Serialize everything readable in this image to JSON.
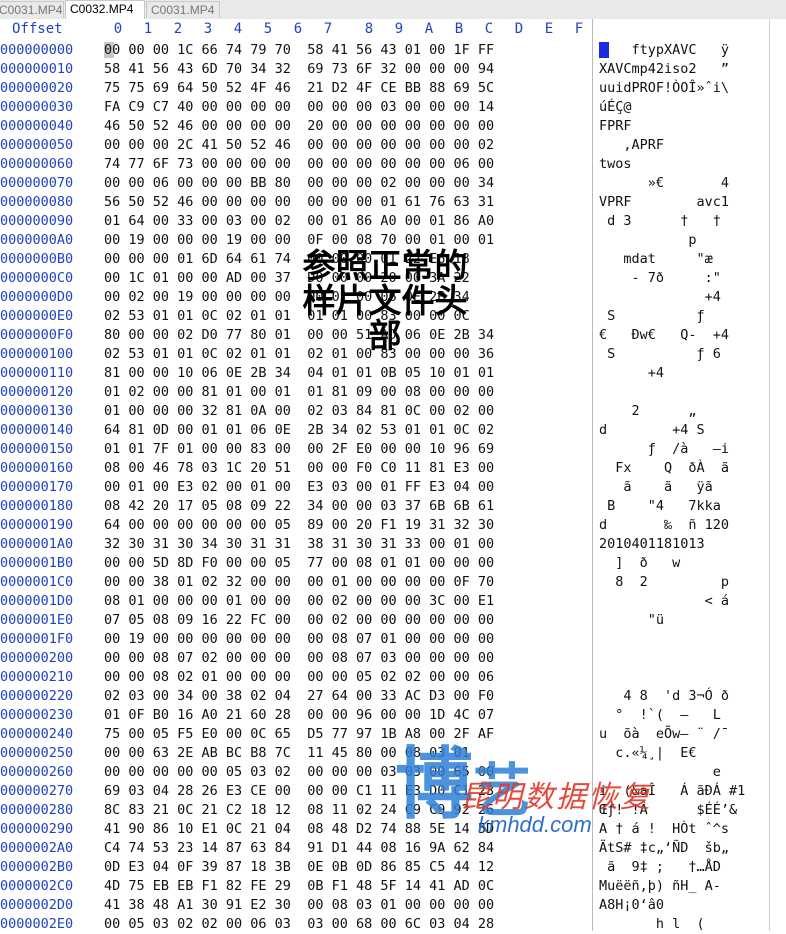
{
  "tabs": [
    {
      "label": "C0031.MP4",
      "active": false
    },
    {
      "label": "C0032.MP4",
      "active": true
    },
    {
      "label": "C0031.MP4",
      "active": false
    }
  ],
  "header": {
    "offset_label": "Offset",
    "columns": [
      "0",
      "1",
      "2",
      "3",
      "4",
      "5",
      "6",
      "7",
      "8",
      "9",
      "A",
      "B",
      "C",
      "D",
      "E",
      "F"
    ]
  },
  "rows": [
    {
      "off": "000000000",
      "hex": "00 00 00 1C 66 74 79 70  58 41 56 43 01 00 1F FF",
      "asc": "    ftypXAVC   ÿ"
    },
    {
      "off": "000000010",
      "hex": "58 41 56 43 6D 70 34 32  69 73 6F 32 00 00 00 94",
      "asc": "XAVCmp42iso2   ”"
    },
    {
      "off": "000000020",
      "hex": "75 75 69 64 50 52 4F 46  21 D2 4F CE BB 88 69 5C",
      "asc": "uuidPROF!ÒOÎ»ˆi\\"
    },
    {
      "off": "000000030",
      "hex": "FA C9 C7 40 00 00 00 00  00 00 00 03 00 00 00 14",
      "asc": "úÉÇ@"
    },
    {
      "off": "000000040",
      "hex": "46 50 52 46 00 00 00 00  20 00 00 00 00 00 00 00",
      "asc": "FPRF"
    },
    {
      "off": "000000050",
      "hex": "00 00 00 2C 41 50 52 46  00 00 00 00 00 00 00 02",
      "asc": "   ,APRF"
    },
    {
      "off": "000000060",
      "hex": "74 77 6F 73 00 00 00 00  00 00 00 00 00 00 06 00",
      "asc": "twos"
    },
    {
      "off": "000000070",
      "hex": "00 00 06 00 00 00 BB 80  00 00 00 02 00 00 00 34",
      "asc": "      »€       4"
    },
    {
      "off": "000000080",
      "hex": "56 50 52 46 00 00 00 00  00 00 00 01 61 76 63 31",
      "asc": "VPRF        avc1"
    },
    {
      "off": "000000090",
      "hex": "01 64 00 33 00 03 00 02  00 01 86 A0 00 01 86 A0",
      "asc": " d 3      †   †"
    },
    {
      "off": "0000000A0",
      "hex": "00 19 00 00 00 19 00 00  0F 00 08 70 00 01 00 01",
      "asc": "           p"
    },
    {
      "off": "0000000B0",
      "hex": "00 00 00 01 6D 64 61 74  00 00 00 01 22 E6 18",
      "asc": "   mdat     \"æ"
    },
    {
      "off": "0000000C0",
      "hex": "00 1C 01 00 00 AD 00 37  D0 00 00 20 00 3A 22",
      "asc": "    - 7ð     :\""
    },
    {
      "off": "0000000D0",
      "hex": "00 02 00 19 00 00 00 00  00 01 00 06 0E 2B 34",
      "asc": "             +4"
    },
    {
      "off": "0000000E0",
      "hex": "02 53 01 01 0C 02 01 01  01 01 00 83 00 00 0C",
      "asc": " S          ƒ"
    },
    {
      "off": "0000000F0",
      "hex": "80 00 00 02 D0 77 80 01  00 00 51 AD 06 0E 2B 34",
      "asc": "€   Ðw€   Q-  +4"
    },
    {
      "off": "000000100",
      "hex": "02 53 01 01 0C 02 01 01  02 01 00 83 00 00 00 36",
      "asc": " S          ƒ 6"
    },
    {
      "off": "000000110",
      "hex": "81 00 00 10 06 0E 2B 34  04 01 01 0B 05 10 01 01",
      "asc": "      +4"
    },
    {
      "off": "000000120",
      "hex": "01 02 00 00 81 01 00 01  01 81 09 00 08 00 00 00",
      "asc": ""
    },
    {
      "off": "000000130",
      "hex": "01 00 00 00 32 81 0A 00  02 03 84 81 0C 00 02 00",
      "asc": "    2      „"
    },
    {
      "off": "000000140",
      "hex": "64 81 0D 00 01 01 06 0E  2B 34 02 53 01 01 0C 02",
      "asc": "d        +4 S"
    },
    {
      "off": "000000150",
      "hex": "01 01 7F 01 00 00 83 00  00 2F E0 00 00 10 96 69",
      "asc": "      ƒ  /à   –i"
    },
    {
      "off": "000000160",
      "hex": "08 00 46 78 03 1C 20 51  00 00 F0 C0 11 81 E3 00",
      "asc": "  Fx    Q  ðÀ  ã"
    },
    {
      "off": "000000170",
      "hex": "00 01 00 E3 02 00 01 00  E3 03 00 01 FF E3 04 00",
      "asc": "   ã    ã   ÿã"
    },
    {
      "off": "000000180",
      "hex": "08 42 20 17 05 08 09 22  34 00 00 03 37 6B 6B 61",
      "asc": " B    \"4   7kka"
    },
    {
      "off": "000000190",
      "hex": "64 00 00 00 00 00 00 05  89 00 20 F1 19 31 32 30",
      "asc": "d       ‰  ñ 120"
    },
    {
      "off": "0000001A0",
      "hex": "32 30 31 30 34 30 31 31  38 31 30 31 33 00 01 00",
      "asc": "2010401181013"
    },
    {
      "off": "0000001B0",
      "hex": "00 00 5D 8D F0 00 00 05  77 00 08 01 01 00 00 00",
      "asc": "  ]  ð   w"
    },
    {
      "off": "0000001C0",
      "hex": "00 00 38 01 02 32 00 00  00 01 00 00 00 00 0F 70",
      "asc": "  8  2         p"
    },
    {
      "off": "0000001D0",
      "hex": "08 01 00 00 00 01 00 00  00 02 00 00 00 3C 00 E1",
      "asc": "             < á"
    },
    {
      "off": "0000001E0",
      "hex": "07 05 08 09 16 22 FC 00  00 02 00 00 00 00 00 00",
      "asc": "      \"ü"
    },
    {
      "off": "0000001F0",
      "hex": "00 19 00 00 00 00 00 00  00 08 07 01 00 00 00 00",
      "asc": ""
    },
    {
      "off": "000000200",
      "hex": "00 00 08 07 02 00 00 00  00 08 07 03 00 00 00 00",
      "asc": ""
    },
    {
      "off": "000000210",
      "hex": "00 00 08 02 01 00 00 00  00 00 05 02 02 00 00 06",
      "asc": ""
    },
    {
      "off": "000000220",
      "hex": "02 03 00 34 00 38 02 04  27 64 00 33 AC D3 00 F0",
      "asc": "   4 8  'd 3¬Ó ð"
    },
    {
      "off": "000000230",
      "hex": "01 0F B0 16 A0 21 60 28  00 00 96 00 00 1D 4C 07",
      "asc": "  °  !`(  –   L"
    },
    {
      "off": "000000240",
      "hex": "75 00 05 F5 E0 00 0C 65  D5 77 97 1B A8 00 2F AF",
      "asc": "u  õà  eÕw— ¨ /¯"
    },
    {
      "off": "000000250",
      "hex": "00 00 63 2E AB BC B8 7C  11 45 80 00 08 03 01",
      "asc": "  c.«¼¸|  E€"
    },
    {
      "off": "000000260",
      "hex": "00 00 00 00 00 05 03 02  00 00 00 03 03 00 65 00",
      "asc": "              e"
    },
    {
      "off": "000000270",
      "hex": "69 03 04 28 26 E3 CE 00  00 00 C1 11 E3 D0 C1 23",
      "asc": "i  (&ãÎ   Á ãÐÁ #1"
    },
    {
      "off": "000000280",
      "hex": "8C 83 21 0C 21 C2 18 12  08 11 02 24 C9 C9 92 26",
      "asc": "Œƒ! !Â      $ÉÉ’&"
    },
    {
      "off": "000000290",
      "hex": "41 90 86 10 E1 0C 21 04  08 48 D2 74 88 5E 14 5D",
      "asc": "A † á !  HÒt ˆ^s"
    },
    {
      "off": "0000002A0",
      "hex": "C4 74 53 23 14 87 63 84  91 D1 44 08 16 9A 62 84",
      "asc": "ÄtS# ‡c„‘ÑD  šb„"
    },
    {
      "off": "0000002B0",
      "hex": "0D E3 04 0F 39 87 18 3B  0E 0B 0D 86 85 C5 44 12",
      "asc": " ã  9‡ ;   †…ÅD"
    },
    {
      "off": "0000002C0",
      "hex": "4D 75 EB EB F1 82 FE 29  0B F1 48 5F 14 41 AD 0C",
      "asc": "Muëëñ‚þ) ñH_ A-"
    },
    {
      "off": "0000002D0",
      "hex": "41 38 48 A1 30 91 E2 30  00 08 03 01 00 00 00 00",
      "asc": "A8H¡0‘â0"
    },
    {
      "off": "0000002E0",
      "hex": "00 05 03 02 02 00 06 03  03 00 68 00 6C 03 04 28",
      "asc": "       h l  ("
    }
  ],
  "overlay_note": "参照正常的样片文件头部",
  "watermark": {
    "big_char": "博",
    "second_char": "艺",
    "cn": "昆明数据恢复",
    "url": "kmhdd.com"
  }
}
